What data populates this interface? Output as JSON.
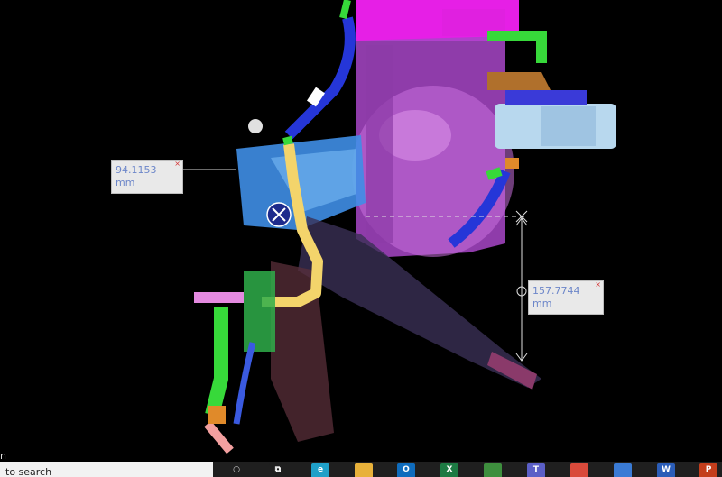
{
  "measurements": {
    "horizontal": {
      "value": "94.1153 mm"
    },
    "vertical": {
      "value": "157.7744 mm"
    },
    "close_glyph": "×"
  },
  "side_text": "n",
  "taskbar": {
    "search_placeholder": "to search",
    "apps": [
      {
        "name": "task-view",
        "glyph": "⧉",
        "color": "#1f1f1f"
      },
      {
        "name": "edge",
        "glyph": "e",
        "color": "#1fa0c8"
      },
      {
        "name": "file-explorer",
        "glyph": "",
        "color": "#e8b13a"
      },
      {
        "name": "outlook",
        "glyph": "O",
        "color": "#0f6cbd"
      },
      {
        "name": "excel",
        "glyph": "X",
        "color": "#1d7a43"
      },
      {
        "name": "app-green",
        "glyph": "",
        "color": "#3e8f3e"
      },
      {
        "name": "teams",
        "glyph": "T",
        "color": "#5b5fc7"
      },
      {
        "name": "chrome",
        "glyph": "",
        "color": "#d94a3b"
      },
      {
        "name": "photos",
        "glyph": "",
        "color": "#3a7bd5"
      },
      {
        "name": "word",
        "glyph": "W",
        "color": "#2b5db8"
      },
      {
        "name": "powerpoint",
        "glyph": "P",
        "color": "#c43e1c"
      }
    ]
  },
  "colors": {
    "background": "#000000",
    "assembly_purple": "#b14bd0",
    "tube_yellow": "#f3d46b",
    "hose_blue": "#2536d8",
    "pipe_green": "#37d93a",
    "bracket_blue": "#3f8ee6",
    "connector_light": "#b8d8ee",
    "magenta": "#ff00ff"
  }
}
